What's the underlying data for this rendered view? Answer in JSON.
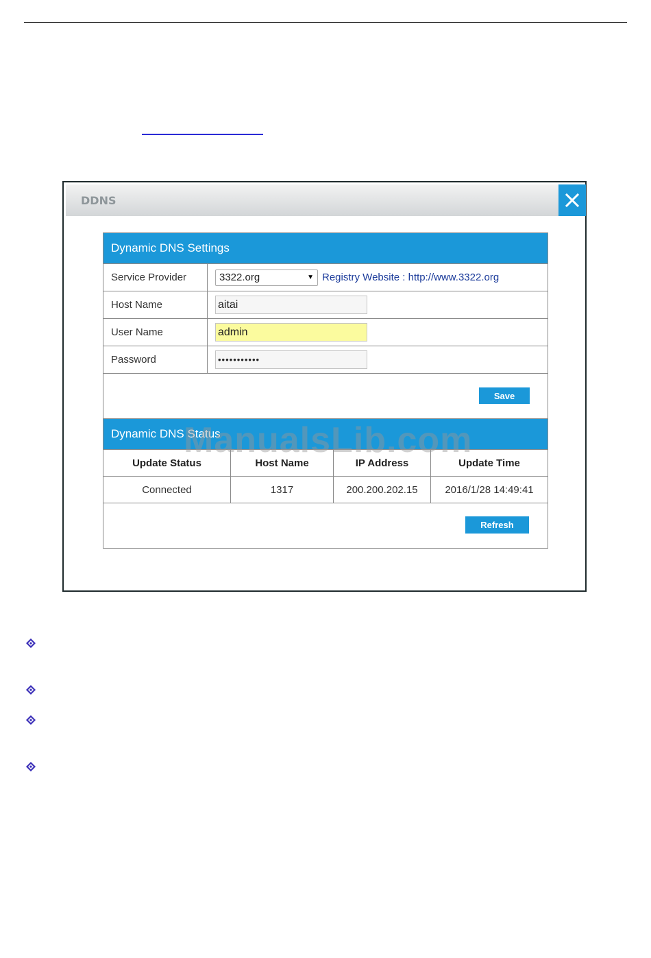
{
  "dialog": {
    "title": "DDNS",
    "close_icon": "close-icon"
  },
  "settings": {
    "section_title": "Dynamic DNS Settings",
    "rows": {
      "service_provider": {
        "label": "Service Provider",
        "value": "3322.org",
        "registry_text": "Registry Website : http://www.3322.org"
      },
      "host_name": {
        "label": "Host Name",
        "value": "aitai"
      },
      "user_name": {
        "label": "User Name",
        "value": "admin"
      },
      "password": {
        "label": "Password",
        "value": "•••••••••••"
      }
    },
    "save_label": "Save"
  },
  "status": {
    "section_title": "Dynamic DNS Status",
    "columns": [
      "Update Status",
      "Host Name",
      "IP Address",
      "Update Time"
    ],
    "row": [
      "Connected",
      "1317",
      "200.200.202.15",
      "2016/1/28 14:49:41"
    ],
    "refresh_label": "Refresh"
  },
  "watermark": "ManualsLib.com",
  "colors": {
    "accent": "#1b98d9",
    "autofill": "#fbfb9e",
    "bullet": "#3b2fb8"
  }
}
